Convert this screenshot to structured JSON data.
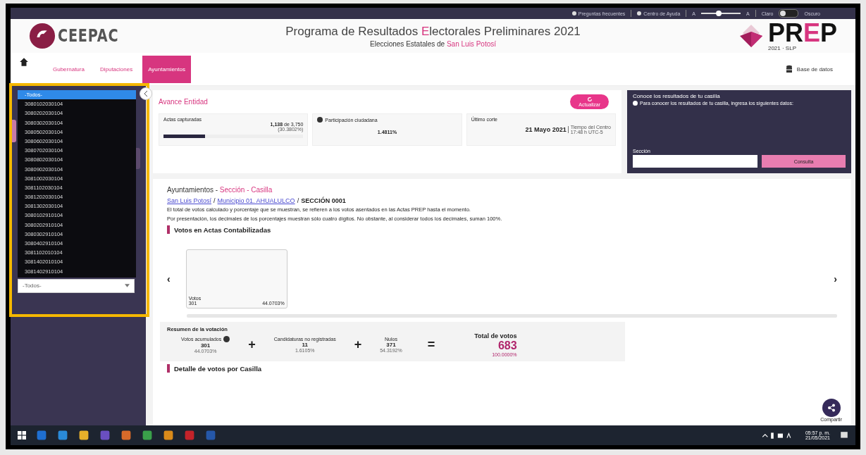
{
  "top_bar": {
    "links": [
      {
        "label": "Preguntas frecuentes"
      },
      {
        "label": "Centro de Ayuda"
      }
    ],
    "font_size": {
      "small": "A",
      "large": "A",
      "level": 0.45
    },
    "theme": {
      "light": "Claro",
      "dark": "Oscuro",
      "on": false
    }
  },
  "header": {
    "logo": "CEEPAC",
    "title": [
      "Programa de Resultados ",
      "E",
      "lectorales Preliminares 2021"
    ],
    "subtitle": [
      "Elecciones Estatales de ",
      "San Luis Potosí"
    ],
    "prep_logo": [
      "PR",
      "E",
      "P"
    ],
    "prep_tagline": "2021 · SLP"
  },
  "nav": {
    "tabs": [
      {
        "label": "Gubernatura",
        "selected": false
      },
      {
        "label": "Diputaciones",
        "selected": false
      },
      {
        "label": "Ayuntamientos",
        "selected": true
      }
    ],
    "database_link": "Base de datos"
  },
  "sidebar": {
    "dropdown_options": [
      {
        "label": "-Todos-",
        "selected": true
      },
      {
        "label": "3080102030104",
        "selected": false
      },
      {
        "label": "3080202030104",
        "selected": false
      },
      {
        "label": "3080302030104",
        "selected": false
      },
      {
        "label": "3080502030104",
        "selected": false
      },
      {
        "label": "3080602030104",
        "selected": false
      },
      {
        "label": "3080702030104",
        "selected": false
      },
      {
        "label": "3080802030104",
        "selected": false
      },
      {
        "label": "3080902030104",
        "selected": false
      },
      {
        "label": "3081002030104",
        "selected": false
      },
      {
        "label": "3081102030104",
        "selected": false
      },
      {
        "label": "3081202030104",
        "selected": false
      },
      {
        "label": "3081302030104",
        "selected": false
      },
      {
        "label": "3080102910104",
        "selected": false
      },
      {
        "label": "3080202910104",
        "selected": false
      },
      {
        "label": "3080302910104",
        "selected": false
      },
      {
        "label": "3080402910104",
        "selected": false
      },
      {
        "label": "3081102010104",
        "selected": false
      },
      {
        "label": "3081402010104",
        "selected": false
      },
      {
        "label": "3081402910104",
        "selected": false
      }
    ],
    "select_value": "-Todos-"
  },
  "avance": {
    "title": "Avance Entidad",
    "refresh_button": "Actualizar",
    "actas": {
      "label": "Actas capturadas",
      "count": "1,138",
      "of": "de 3,750",
      "percent": "(30.3802%)",
      "level": 0.3
    },
    "participacion": {
      "label": "Participación ciudadana",
      "value": "1.4811%"
    },
    "corte": {
      "label": "Último corte",
      "date": "21 Mayo 2021",
      "zone": "Tiempo del Centro",
      "time": "17:48 h UTC-5"
    }
  },
  "casilla_panel": {
    "title": "Conoce los resultados de tu casilla",
    "hint": "Para conocer los resultados de tu casilla, ingresa los siguientes datos:",
    "field_label": "Sección",
    "button": "Consulta"
  },
  "results": {
    "heading": [
      "Ayuntamientos - ",
      "Sección - Casilla"
    ],
    "breadcrumb_separator": "/",
    "breadcrumbs": [
      {
        "label": "San Luis Potosí",
        "kind": "link"
      },
      {
        "label": "Municipio 01. AHUALULCO",
        "kind": "link"
      },
      {
        "label": "SECCIÓN 0001",
        "kind": "current"
      }
    ],
    "notes": [
      "El total de votos calculado y porcentaje que se muestran, se refieren a los votos asentados en las Actas PREP hasta el momento.",
      "Por presentación, los decimales de los porcentajes muestran sólo cuatro dígitos. No obstante, al considerar todos los decimales, suman 100%."
    ],
    "votes_title": "Votos en Actas Contabilizadas",
    "carousel": {
      "prev": "‹",
      "next": "›",
      "cards": [
        {
          "label": "Votos",
          "votes": "301",
          "percent": "44.0703%"
        }
      ]
    },
    "summary": {
      "title": "Resumen de la votación",
      "items": [
        {
          "label": "Votos acumulados",
          "value": "301",
          "percent": "44.0703%",
          "info": true
        },
        {
          "label": "Candidaturas no registradas",
          "value": "11",
          "percent": "1.6105%",
          "info": false
        },
        {
          "label": "Nulos",
          "value": "371",
          "percent": "54.3192%",
          "info": false
        }
      ],
      "plus": "+",
      "equals": "=",
      "total_label": "Total de votos",
      "total": "683",
      "total_percent": "100.0000%"
    },
    "detail_title": "Detalle de votos por Casilla",
    "share_button": "Compartir"
  },
  "taskbar": {
    "time": "05:57 p. m.",
    "date": "21/05/2021"
  }
}
